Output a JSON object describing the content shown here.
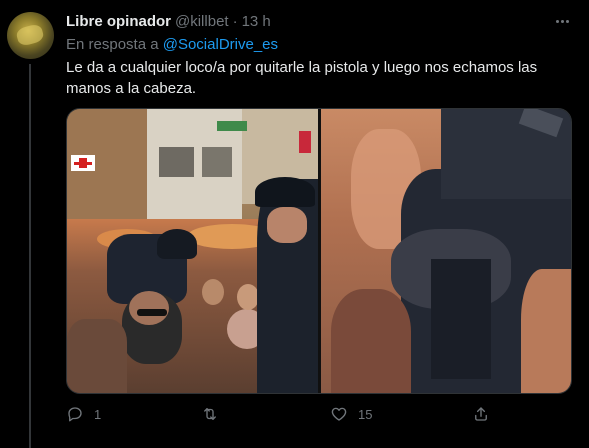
{
  "tweet": {
    "author_name": "Libre opinador",
    "author_handle": "@killbet",
    "separator": "·",
    "time": "13 h",
    "reply_prefix": "En resposta a",
    "reply_mention": "@SocialDrive_es",
    "text": "Le da a cualquier loco/a por quitarle la pistola y luego nos echamos las manos a la cabeza."
  },
  "actions": {
    "reply_count": "1",
    "retweet_count": "",
    "like_count": "15"
  },
  "icons": {
    "more": "more-icon",
    "reply": "reply-icon",
    "retweet": "retweet-icon",
    "like": "heart-icon",
    "share": "share-icon"
  },
  "colors": {
    "background": "#000000",
    "text": "#e7e9ea",
    "secondary": "#71767b",
    "link": "#1d9bf0"
  }
}
